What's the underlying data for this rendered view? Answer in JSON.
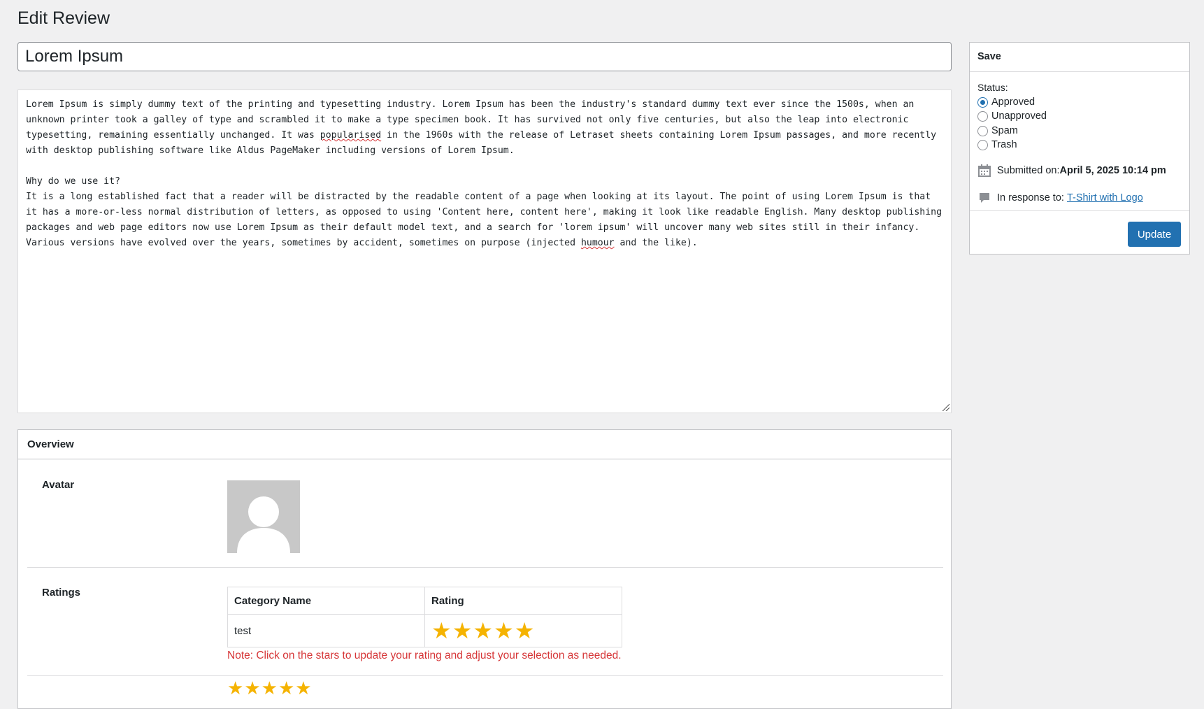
{
  "page": {
    "title": "Edit Review"
  },
  "review": {
    "title": "Lorem Ipsum",
    "paragraph1_a": "Lorem Ipsum is simply dummy text of the printing and typesetting industry. Lorem Ipsum has been the industry's standard dummy text ever since the 1500s, when an unknown printer took a galley of type and scrambled it to make a type specimen book. It has survived not only five centuries, but also the leap into electronic typesetting, remaining essentially unchanged. It was ",
    "paragraph1_misspelled": "popularised",
    "paragraph1_b": " in the 1960s with the release of Letraset sheets containing Lorem Ipsum passages, and more recently with desktop publishing software like Aldus PageMaker including versions of Lorem Ipsum.",
    "heading2": "Why do we use it?",
    "paragraph2_a": "It is a long established fact that a reader will be distracted by the readable content of a page when looking at its layout. The point of using Lorem Ipsum is that it has a more-or-less normal distribution of letters, as opposed to using 'Content here, content here', making it look like readable English. Many desktop publishing packages and web page editors now use Lorem Ipsum as their default model text, and a search for 'lorem ipsum' will uncover many web sites still in their infancy. Various versions have evolved over the years, sometimes by accident, sometimes on purpose (injected ",
    "paragraph2_misspelled": "humour",
    "paragraph2_b": " and the like)."
  },
  "overview": {
    "heading": "Overview",
    "avatar_label": "Avatar",
    "ratings_label": "Ratings",
    "ratings_table": {
      "headers": [
        "Category Name",
        "Rating"
      ],
      "rows": [
        {
          "category": "test",
          "rating": 5,
          "max": 5
        }
      ]
    },
    "note": "Note: Click on the stars to update your rating and adjust your selection as needed.",
    "average_rating": 5
  },
  "save": {
    "heading": "Save",
    "status_label": "Status:",
    "statuses": [
      "Approved",
      "Unapproved",
      "Spam",
      "Trash"
    ],
    "selected_status": "Approved",
    "submitted_label": "Submitted on: ",
    "submitted_value": "April 5, 2025 10:14 pm",
    "response_label": "In response to: ",
    "response_link": "T-Shirt with Logo",
    "update_label": "Update"
  },
  "colors": {
    "accent": "#2271b1",
    "star": "#f5b301",
    "note": "#d63638"
  }
}
